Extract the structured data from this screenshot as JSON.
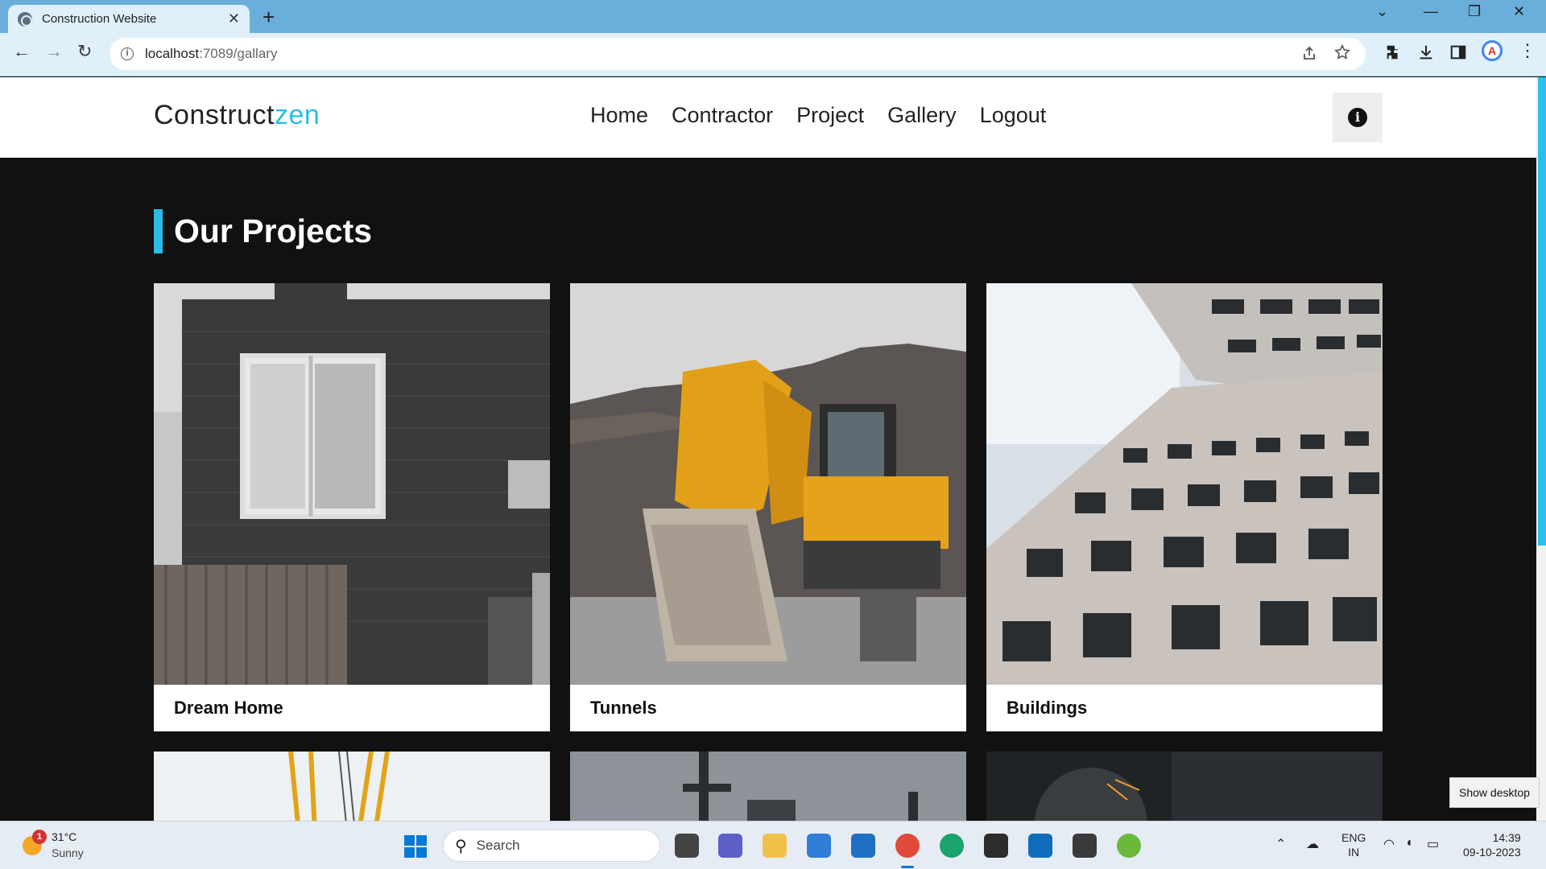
{
  "browser": {
    "tab_title": "Construction Website",
    "tab_close": "✕",
    "new_tab": "+",
    "url_host": "localhost",
    "url_path": ":7089/gallary",
    "window_controls": {
      "dropdown": "⌄",
      "minimize": "—",
      "restore": "❐",
      "close": "✕"
    },
    "nav": {
      "back": "←",
      "forward": "→",
      "reload": "↻"
    }
  },
  "site": {
    "logo_main": "Construct",
    "logo_accent": "zen",
    "menu": [
      "Home",
      "Contractor",
      "Project",
      "Gallery",
      "Logout"
    ],
    "info_icon": "i",
    "accent_color": "#29bde6"
  },
  "gallery": {
    "title": "Our Projects",
    "cards": [
      {
        "caption": "Dream Home"
      },
      {
        "caption": "Tunnels"
      },
      {
        "caption": "Buildings"
      }
    ]
  },
  "taskbar": {
    "weather_badge": "1",
    "weather_temp": "31°C",
    "weather_desc": "Sunny",
    "search_label": "Search",
    "lang_line1": "ENG",
    "lang_line2": "IN",
    "time": "14:39",
    "date": "09-10-2023",
    "tooltip": "Show desktop"
  }
}
